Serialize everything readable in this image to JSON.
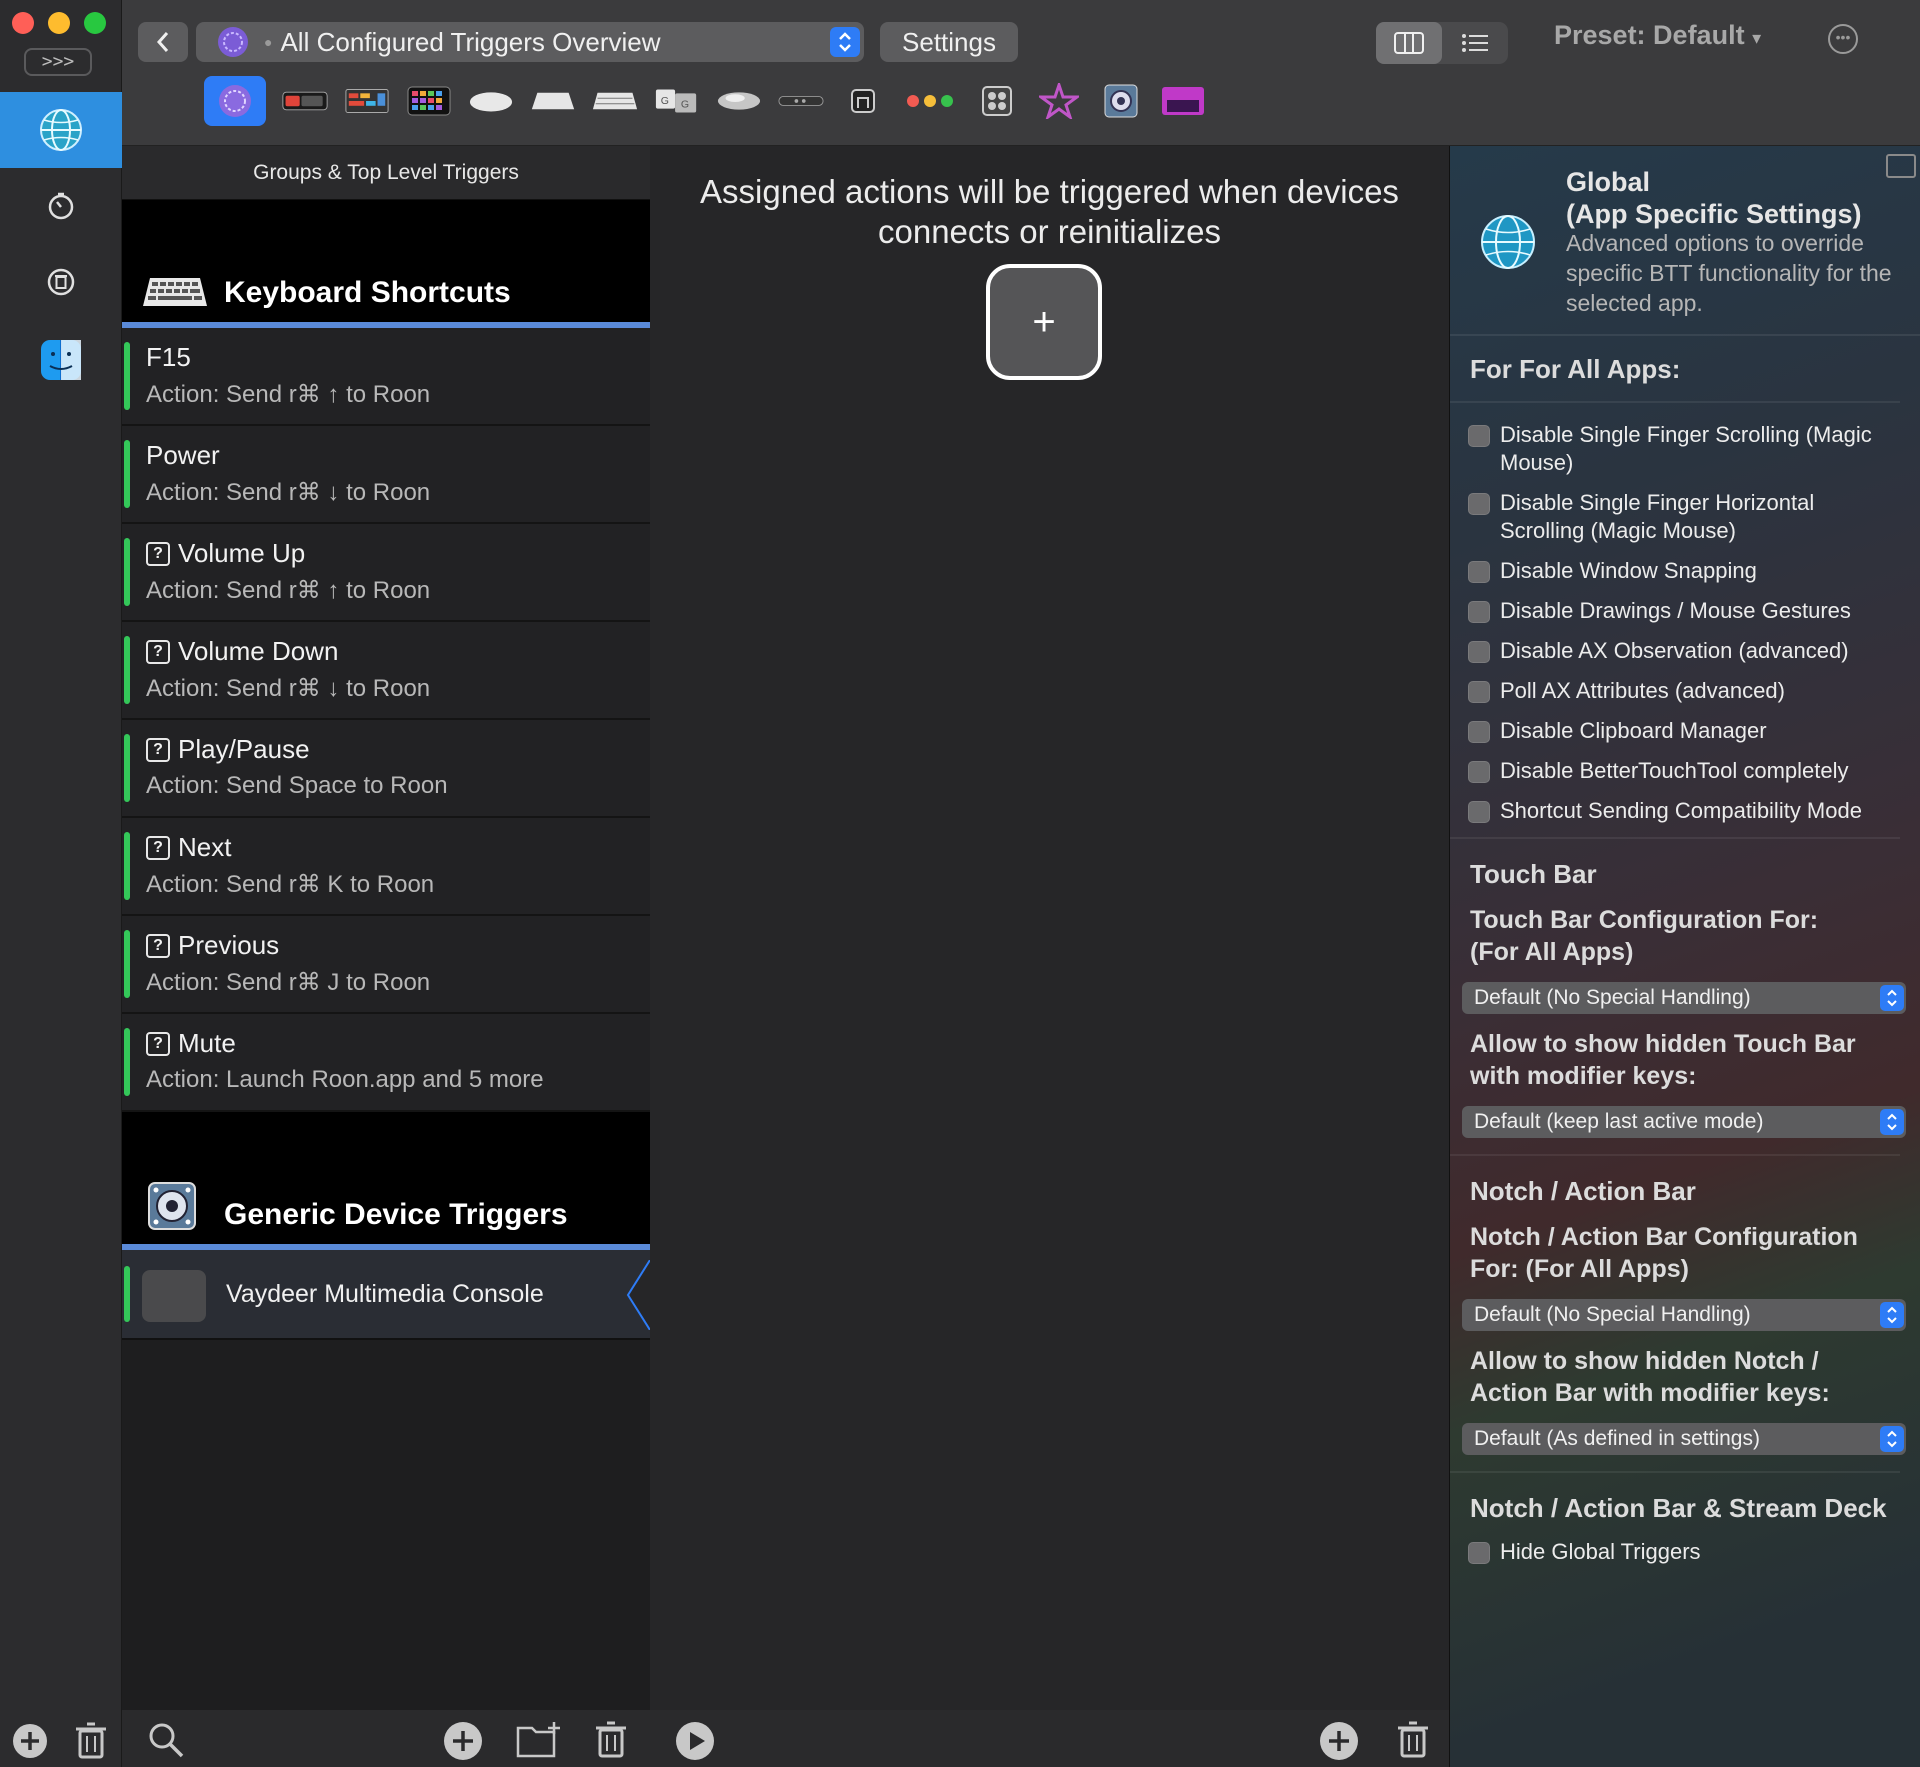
{
  "app": {
    "expand_label": ">>>"
  },
  "toolbar": {
    "selected_trigger": "All Configured Triggers Overview",
    "settings_label": "Settings",
    "preset_label": "Preset: Default",
    "preset_caret": "▾"
  },
  "groups": {
    "header": "Groups & Top Level Triggers",
    "keyboard_section": "Keyboard Shortcuts",
    "triggers": [
      {
        "name": "F15",
        "action": "Action: Send r⌘  ↑ to Roon",
        "has_q": false
      },
      {
        "name": "Power",
        "action": "Action: Send r⌘  ↓ to Roon",
        "has_q": false
      },
      {
        "name": "Volume Up",
        "action": "Action: Send r⌘  ↑ to Roon",
        "has_q": true
      },
      {
        "name": "Volume Down",
        "action": "Action: Send r⌘  ↓ to Roon",
        "has_q": true
      },
      {
        "name": "Play/Pause",
        "action": "Action: Send  Space to Roon",
        "has_q": true
      },
      {
        "name": "Next",
        "action": "Action: Send r⌘  K to Roon",
        "has_q": true
      },
      {
        "name": "Previous",
        "action": "Action: Send r⌘  J to Roon",
        "has_q": true
      },
      {
        "name": "Mute",
        "action": "Action: Launch Roon.app and 5 more",
        "has_q": true
      }
    ],
    "generic_section": "Generic Device Triggers",
    "device_name": "Vaydeer Multimedia Console"
  },
  "middle": {
    "message_line1": "Assigned actions will be triggered when devices",
    "message_line2": "connects or reinitializes",
    "add_symbol": "+"
  },
  "settings": {
    "title_line1": "Global",
    "title_line2": "(App Specific Settings)",
    "description": "Advanced options to override specific BTT functionality for the selected app.",
    "for_all_apps": "For For All Apps:",
    "checkboxes": [
      "Disable Single Finger Scrolling (Magic Mouse)",
      "Disable Single Finger Horizontal Scrolling (Magic Mouse)",
      "Disable Window Snapping",
      "Disable Drawings / Mouse Gestures",
      "Disable AX Observation (advanced)",
      "Poll AX Attributes (advanced)",
      "Disable Clipboard Manager",
      "Disable BetterTouchTool completely",
      "Shortcut Sending Compatibility Mode"
    ],
    "touchbar_title": "Touch Bar",
    "touchbar_config_label": "Touch Bar Configuration For: (For All Apps)",
    "touchbar_config_value": "Default (No Special Handling)",
    "touchbar_hidden_label": "Allow to show hidden Touch Bar with modifier keys:",
    "touchbar_hidden_value": "Default (keep last active mode)",
    "notch_title": "Notch / Action Bar",
    "notch_config_label": "Notch / Action Bar Configuration For:  (For All Apps)",
    "notch_config_value": "Default (No Special Handling)",
    "notch_hidden_label": "Allow to show hidden Notch / Action Bar with modifier keys:",
    "notch_hidden_value": "Default (As defined in settings)",
    "stream_title": "Notch / Action Bar & Stream Deck",
    "hide_global": "Hide Global Triggers"
  }
}
